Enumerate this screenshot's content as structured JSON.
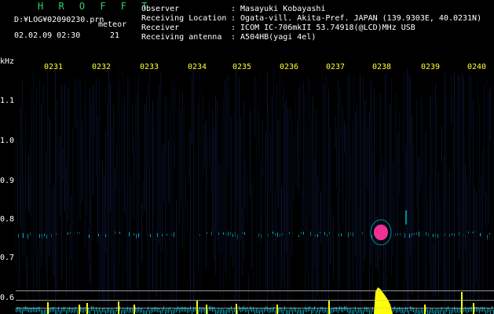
{
  "app": {
    "title": "H R O F F T"
  },
  "file": {
    "path": "D:¥LOG¥02090230.prn",
    "date_time": "02.02.09 02:30",
    "count_label": "meteor",
    "count": "21"
  },
  "info": {
    "labels": [
      "Observer",
      "Receiving Location",
      "Receiver",
      "Receiving antenna"
    ],
    "values": [
      ": Masayuki Kobayashi",
      ": Ogata-vill. Akita-Pref. JAPAN (139.9303E, 40.0231N)",
      ": ICOM IC-706mkII 53.74918(@LCD)MHz USB",
      ": A504HB(yagi 4el)"
    ]
  },
  "spectrogram": {
    "y_unit": "kHz",
    "y_ticks": [
      "1.1",
      "1.0",
      "0.9",
      "0.8",
      "0.7",
      "0.6"
    ],
    "x_ticks": [
      "0231",
      "0232",
      "0233",
      "0234",
      "0235",
      "0236",
      "0237",
      "0238",
      "0239",
      "0240"
    ],
    "colors": {
      "noise": "#1a2a66",
      "echo": "#ff3399",
      "trace": "#00e0ff",
      "peak": "#ffff00"
    }
  }
}
